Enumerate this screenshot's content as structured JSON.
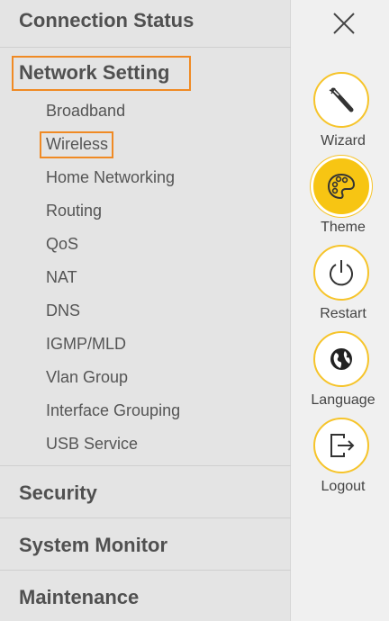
{
  "menu": {
    "connection_status": "Connection Status",
    "network_setting": "Network Setting",
    "network_items": [
      {
        "label": "Broadband"
      },
      {
        "label": "Wireless"
      },
      {
        "label": "Home Networking"
      },
      {
        "label": "Routing"
      },
      {
        "label": "QoS"
      },
      {
        "label": "NAT"
      },
      {
        "label": "DNS"
      },
      {
        "label": "IGMP/MLD"
      },
      {
        "label": "Vlan Group"
      },
      {
        "label": "Interface Grouping"
      },
      {
        "label": "USB Service"
      }
    ],
    "security": "Security",
    "system_monitor": "System Monitor",
    "maintenance": "Maintenance"
  },
  "side": {
    "close_icon": "close-icon",
    "actions": [
      {
        "label": "Wizard",
        "icon": "wand-icon"
      },
      {
        "label": "Theme",
        "icon": "palette-icon"
      },
      {
        "label": "Restart",
        "icon": "power-icon"
      },
      {
        "label": "Language",
        "icon": "globe-icon"
      },
      {
        "label": "Logout",
        "icon": "logout-icon"
      }
    ]
  },
  "colors": {
    "highlight": "#f08a24",
    "accent": "#f7c513",
    "menu_bg": "#e4e4e4",
    "text": "#505050"
  }
}
